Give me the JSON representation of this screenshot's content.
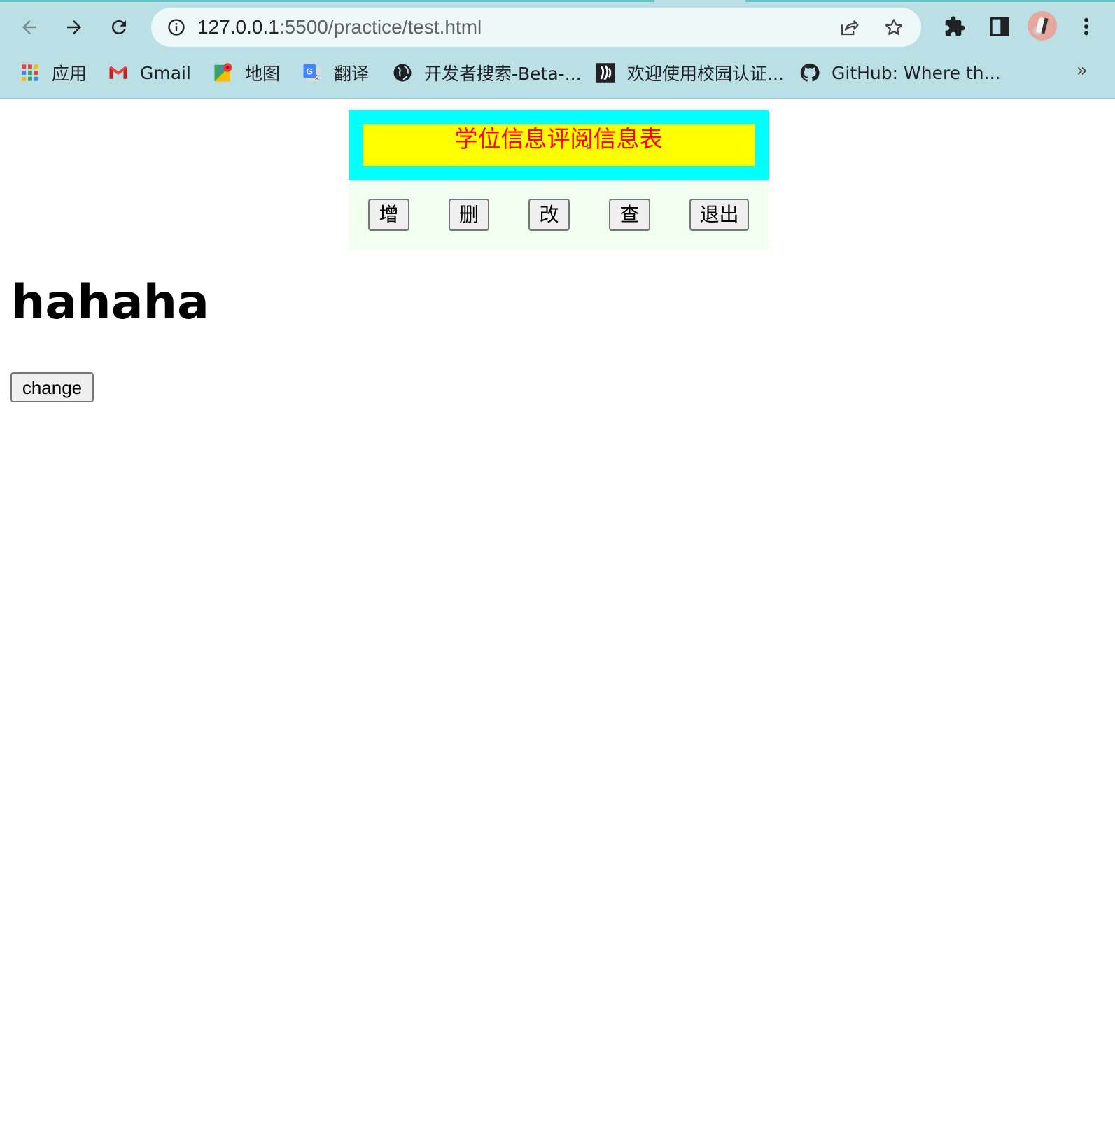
{
  "browser": {
    "url_host": "127.0.0.1",
    "url_rest": ":5500/practice/test.html",
    "bookmarks": [
      {
        "label": "应用",
        "icon": "apps-grid-icon"
      },
      {
        "label": "Gmail",
        "icon": "gmail-icon"
      },
      {
        "label": "地图",
        "icon": "maps-icon"
      },
      {
        "label": "翻译",
        "icon": "translate-icon"
      },
      {
        "label": "开发者搜索-Beta-...",
        "icon": "globe-icon"
      },
      {
        "label": "欢迎使用校园认证...",
        "icon": "campus-logo-icon"
      },
      {
        "label": "GitHub: Where th...",
        "icon": "github-icon"
      }
    ],
    "more_label": "»"
  },
  "page": {
    "title": "学位信息评阅信息表",
    "menu_buttons": [
      "增",
      "删",
      "改",
      "查",
      "退出"
    ],
    "headline": "hahaha",
    "change_button": "change"
  },
  "colors": {
    "header_bg": "#00ffff",
    "title_bg": "#ffff00",
    "title_text": "#ff0000",
    "menu_bg": "#f0fff0",
    "chrome_bg": "#bae0e6"
  }
}
